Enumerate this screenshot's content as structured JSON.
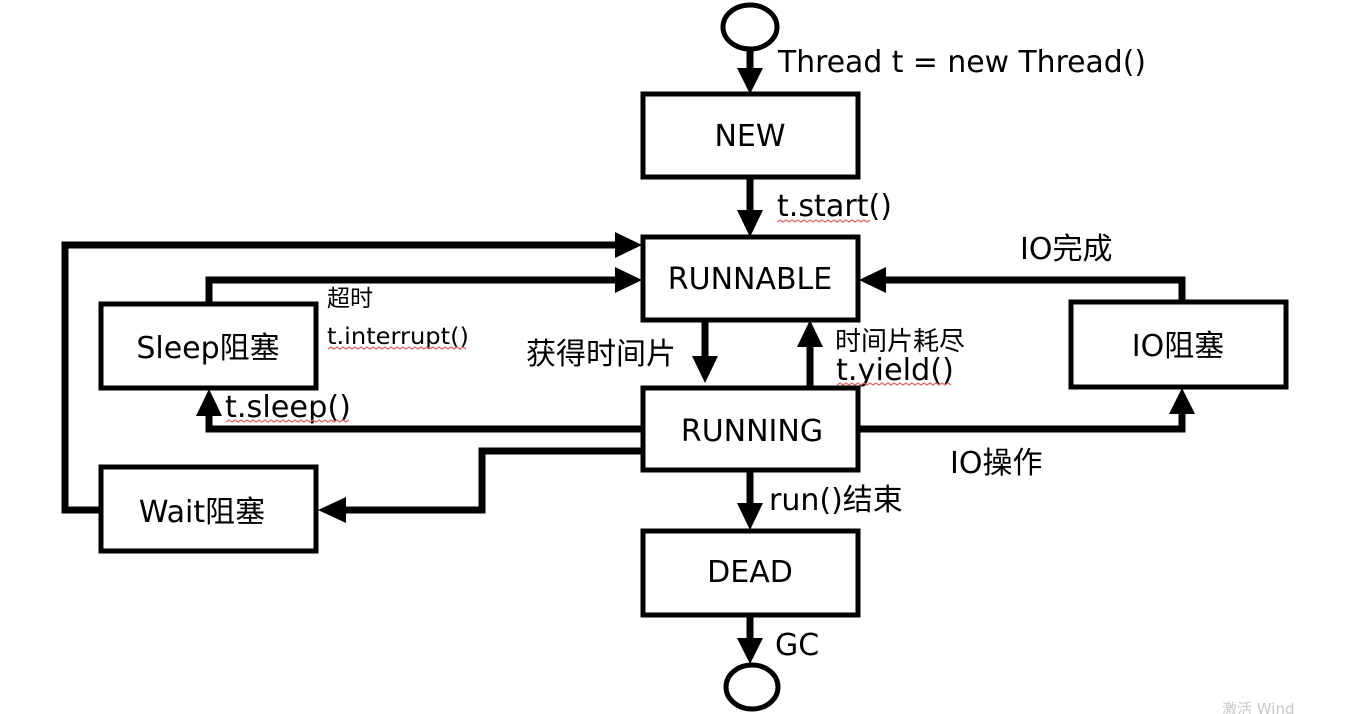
{
  "states": {
    "new": "NEW",
    "runnable": "RUNNABLE",
    "running": "RUNNING",
    "dead": "DEAD",
    "sleep_blocked": "Sleep阻塞",
    "wait_blocked": "Wait阻塞",
    "io_blocked": "IO阻塞"
  },
  "transitions": {
    "create": "Thread t = new Thread()",
    "start": "t.start()",
    "get_time_slice": "获得时间片",
    "time_slice_exhausted": "时间片耗尽",
    "yield": "t.yield()",
    "sleep": "t.sleep()",
    "sleep_timeout": "超时",
    "sleep_interrupt": "t.interrupt()",
    "io_operation": "IO操作",
    "io_complete": "IO完成",
    "run_finished": "run()结束",
    "gc": "GC"
  },
  "watermark": "激活 Wind"
}
